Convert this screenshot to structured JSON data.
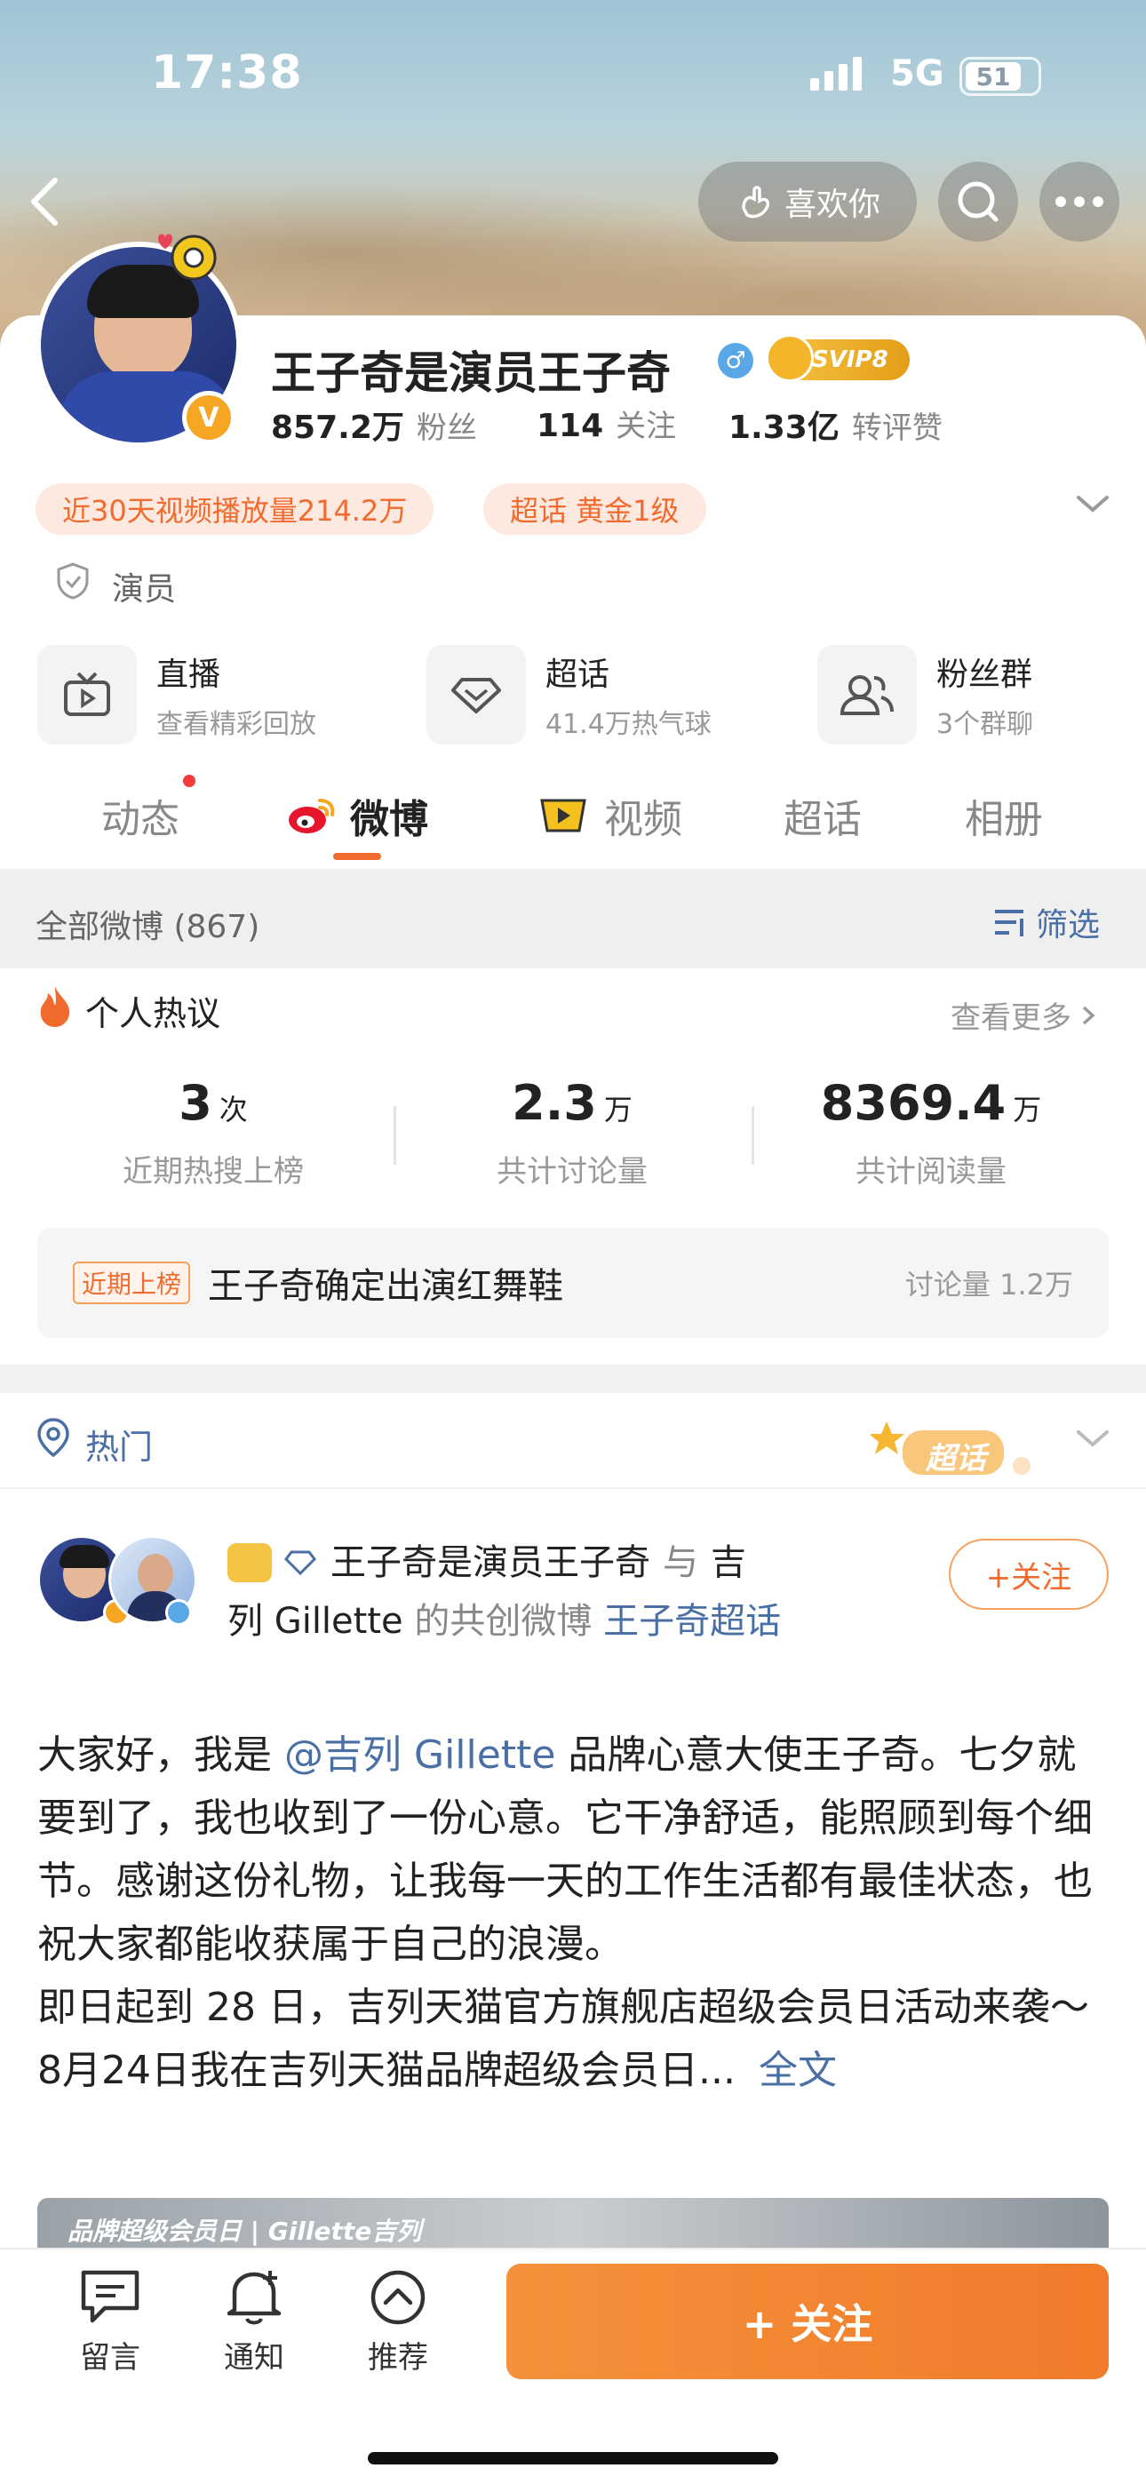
{
  "status_bar": {
    "time": "17:38",
    "network": "5G",
    "battery": "51"
  },
  "header": {
    "like_label": "喜欢你"
  },
  "profile": {
    "name": "王子奇是演员王子奇",
    "vip_label": "SVIP8",
    "fans_count": "857.2万",
    "fans_label": "粉丝",
    "follow_count": "114",
    "follow_label": "关注",
    "likes_count": "1.33亿",
    "likes_label": "转评赞",
    "tags": [
      "近30天视频播放量214.2万",
      "超话 黄金1级"
    ],
    "verification": "演员"
  },
  "shortcuts": [
    {
      "title": "直播",
      "sub": "查看精彩回放"
    },
    {
      "title": "超话",
      "sub": "41.4万热气球"
    },
    {
      "title": "粉丝群",
      "sub": "3个群聊"
    }
  ],
  "tabs": [
    "动态",
    "微博",
    "视频",
    "超话",
    "相册"
  ],
  "feed_filter": {
    "all_label": "全部微博 (867)",
    "filter_label": "筛选"
  },
  "hot_discussion": {
    "title": "个人热议",
    "more_label": "查看更多",
    "stats": [
      {
        "value": "3",
        "unit": "次",
        "caption": "近期热搜上榜"
      },
      {
        "value": "2.3",
        "unit": "万",
        "caption": "共计讨论量"
      },
      {
        "value": "8369.4",
        "unit": "万",
        "caption": "共计阅读量"
      }
    ],
    "recent_badge": "近期上榜",
    "recent_topic": "王子奇确定出演红舞鞋",
    "recent_count": "讨论量 1.2万"
  },
  "hot_section": {
    "label": "热门",
    "chaohua_sticker": "超话"
  },
  "post": {
    "authors_line1_name": "王子奇是演员王子奇",
    "authors_line1_and": "与",
    "authors_line1_tail": "吉",
    "authors_line2_a": "列 Gillette",
    "authors_line2_b": "的共创微博",
    "authors_line2_link": "王子奇超话",
    "follow_label": "+关注",
    "body_1": "大家好，我是",
    "body_mention": "@吉列 Gillette",
    "body_2": "品牌心意大使王子奇。七夕就要到了，我也收到了一份心意。它干净舒适，能照顾到每个细节。感谢这份礼物，让我每一天的工作生活都有最佳状态，也祝大家都能收获属于自己的浪漫。",
    "body_3": "即日起到 28 日，吉列天猫官方旗舰店超级会员日活动来袭～ 8月24日我在吉列天猫品牌超级会员日...",
    "full_text_label": "全文",
    "image_caption": "品牌超级会员日 | Gillette吉列"
  },
  "bottom_bar": {
    "items": [
      "留言",
      "通知",
      "推荐"
    ],
    "follow_label": "+ 关注"
  },
  "colors": {
    "accent": "#f26b2e",
    "link": "#4a6fa5",
    "orange_btn": "#f5913a"
  }
}
